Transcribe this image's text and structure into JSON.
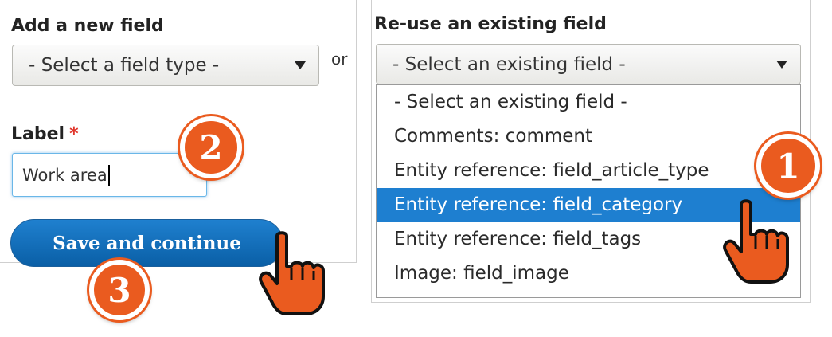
{
  "add_new": {
    "heading": "Add a new field",
    "select_value": "- Select a field type -"
  },
  "or_text": "or",
  "reuse": {
    "heading": "Re-use an existing field",
    "select_value": "- Select an existing field -",
    "options": [
      "- Select an existing field -",
      "Comments: comment",
      "Entity reference: field_article_type",
      "Entity reference: field_category",
      "Entity reference: field_tags",
      "Image: field_image"
    ],
    "selected_option": "Entity reference: field_category"
  },
  "label": {
    "text": "Label",
    "required_marker": "*",
    "value": "Work area"
  },
  "save_button": "Save and continue",
  "steps": [
    "1",
    "2",
    "3"
  ],
  "colors": {
    "accent_blue": "#1e7fd0",
    "badge_orange": "#ea5b1f",
    "required_red": "#e0362c"
  },
  "icons": [
    "pointing-hand-icon",
    "chevron-down-icon"
  ]
}
